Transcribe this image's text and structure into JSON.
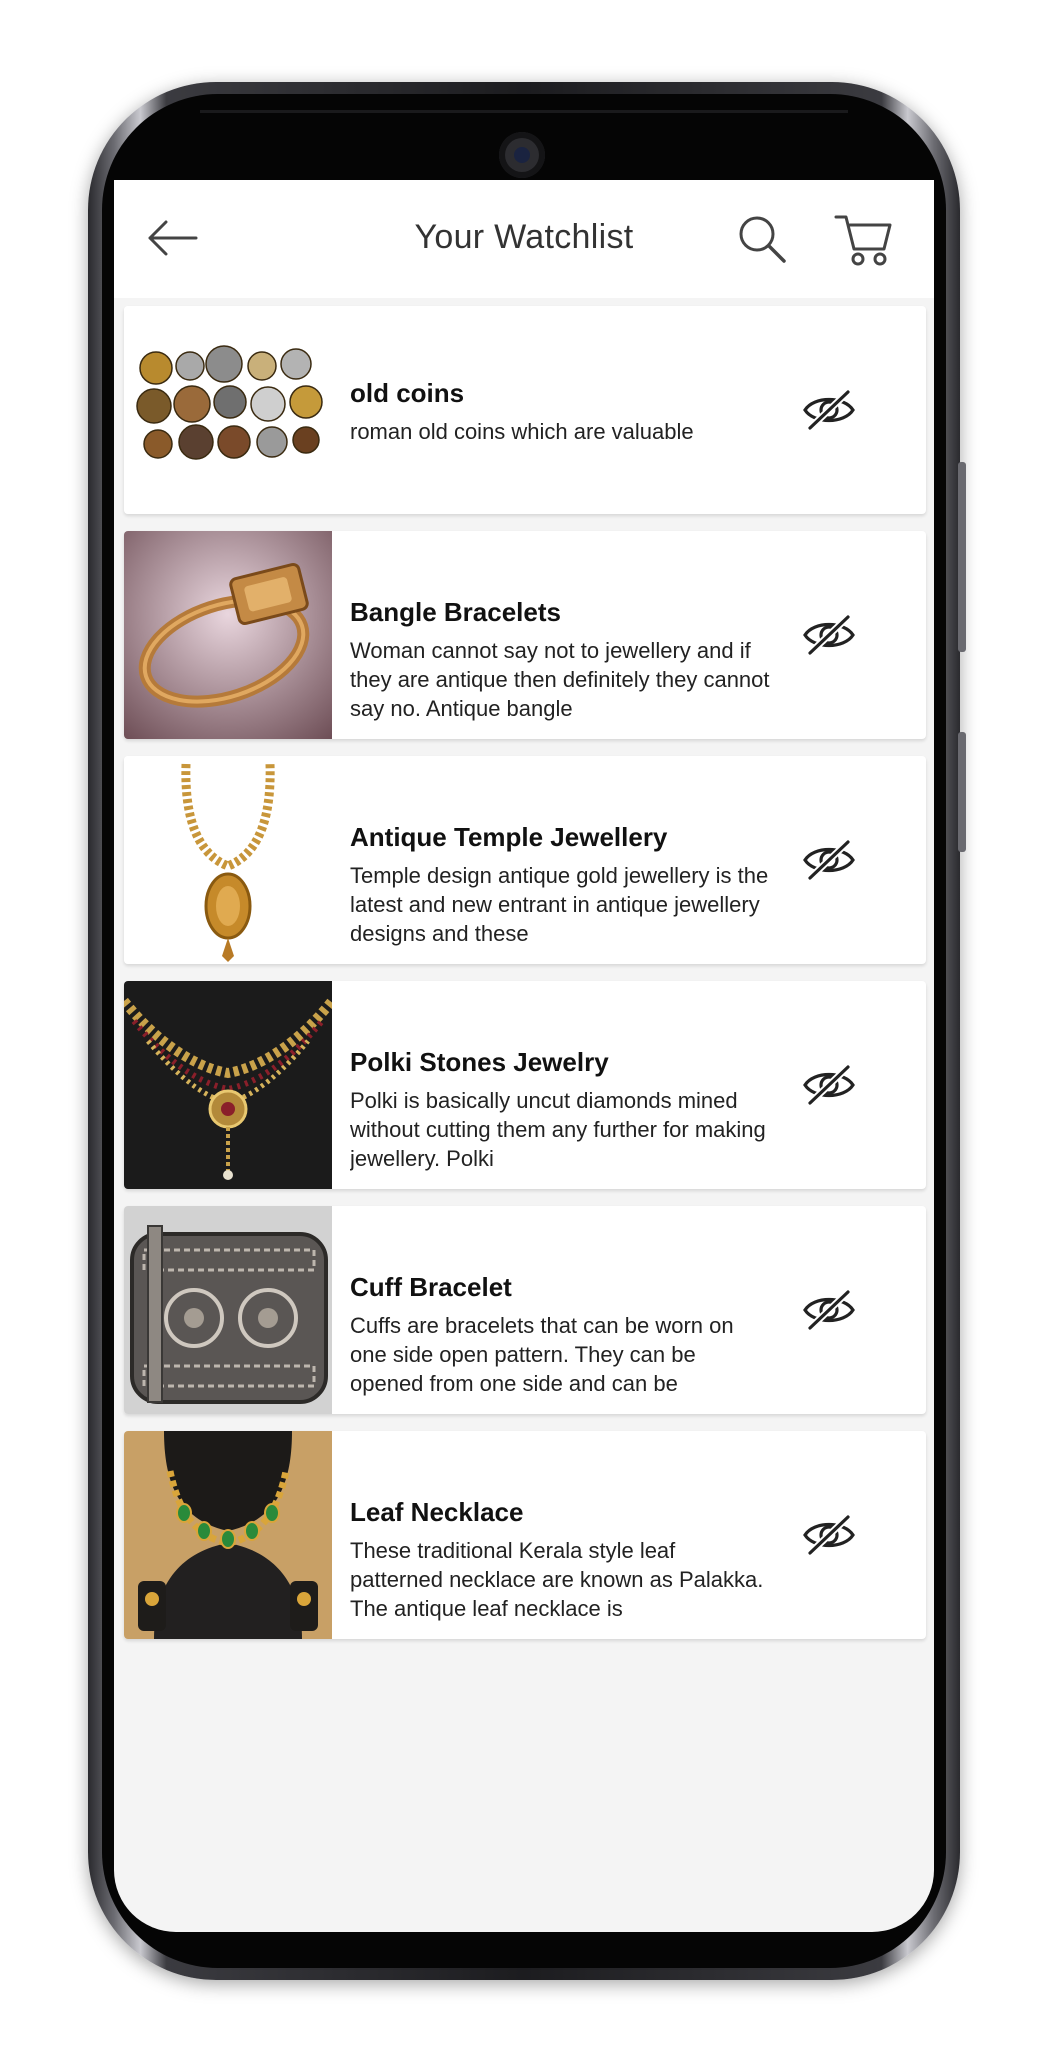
{
  "header": {
    "title": "Your Watchlist",
    "back_icon": "arrow-left-icon",
    "search_icon": "search-icon",
    "cart_icon": "cart-icon"
  },
  "items": [
    {
      "title": "old coins",
      "description": "roman old coins which are valuable",
      "image": "old-coins-photo",
      "action_icon": "eye-off-icon"
    },
    {
      "title": "Bangle Bracelets",
      "description": "Woman cannot say not to jewellery and if they are antique then definitely they cannot say no. Antique bangle",
      "image": "bangle-bracelet-photo",
      "action_icon": "eye-off-icon"
    },
    {
      "title": "Antique Temple Jewellery",
      "description": "Temple design antique gold jewellery is the latest and new entrant in antique jewellery designs and these",
      "image": "temple-necklace-photo",
      "action_icon": "eye-off-icon"
    },
    {
      "title": "Polki Stones Jewelry",
      "description": "Polki is basically uncut diamonds mined without cutting them any further for making jewellery. Polki",
      "image": "polki-necklace-photo",
      "action_icon": "eye-off-icon"
    },
    {
      "title": "Cuff Bracelet",
      "description": "Cuffs are bracelets that can be worn on one side open pattern. They can be opened from one side and can be",
      "image": "cuff-bracelet-photo",
      "action_icon": "eye-off-icon"
    },
    {
      "title": "Leaf Necklace",
      "description": "These traditional Kerala style leaf patterned necklace are known as Palakka. The antique leaf necklace is",
      "image": "leaf-necklace-photo",
      "action_icon": "eye-off-icon"
    }
  ]
}
